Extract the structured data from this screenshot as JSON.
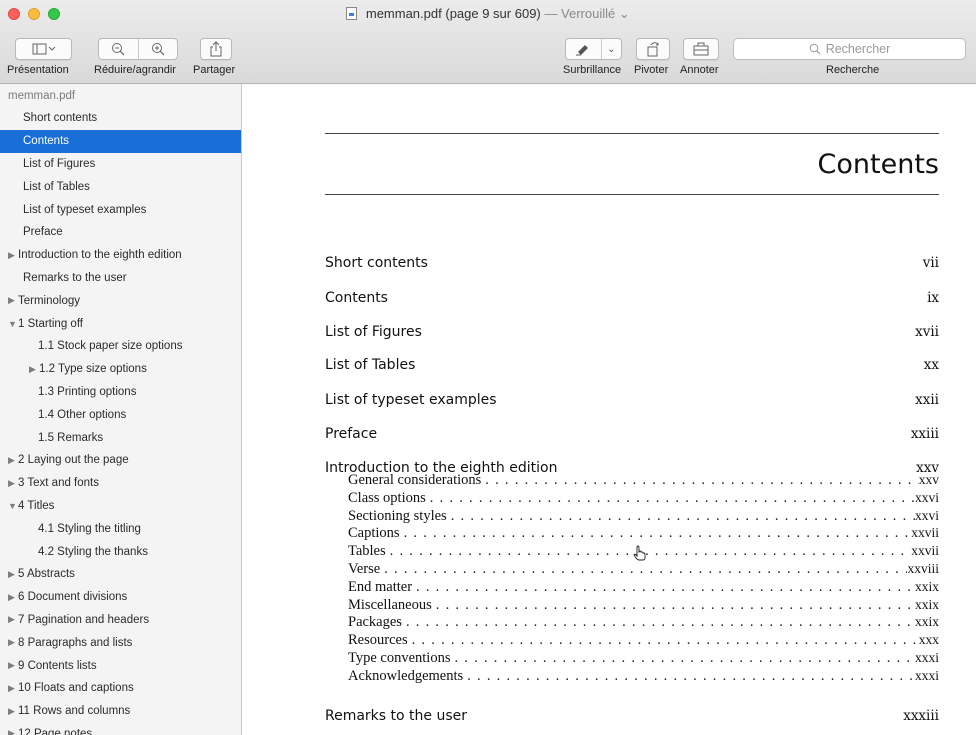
{
  "window": {
    "filename": "memman.pdf",
    "page_info": "(page 9 sur 609)",
    "separator": "—",
    "status": "Verrouillé"
  },
  "toolbar": {
    "presentation_label": "Présentation",
    "zoom_label": "Réduire/agrandir",
    "share_label": "Partager",
    "highlight_label": "Surbrillance",
    "rotate_label": "Pivoter",
    "annotate_label": "Annoter",
    "search_placeholder": "Rechercher",
    "search_label": "Recherche"
  },
  "sidebar": {
    "header": "memman.pdf",
    "items": [
      {
        "label": "Short contents",
        "level": 1,
        "arrow": "none",
        "selected": false
      },
      {
        "label": "Contents",
        "level": 1,
        "arrow": "none",
        "selected": true
      },
      {
        "label": "List of Figures",
        "level": 1,
        "arrow": "none",
        "selected": false
      },
      {
        "label": "List of Tables",
        "level": 1,
        "arrow": "none",
        "selected": false
      },
      {
        "label": "List of typeset examples",
        "level": 1,
        "arrow": "none",
        "selected": false
      },
      {
        "label": "Preface",
        "level": 1,
        "arrow": "none",
        "selected": false
      },
      {
        "label": "Introduction to the eighth edition",
        "level": 0,
        "arrow": "right",
        "selected": false
      },
      {
        "label": "Remarks to the user",
        "level": 1,
        "arrow": "none",
        "selected": false
      },
      {
        "label": "Terminology",
        "level": 0,
        "arrow": "right",
        "selected": false
      },
      {
        "label": "1 Starting off",
        "level": 0,
        "arrow": "down",
        "selected": false
      },
      {
        "label": "1.1 Stock paper size options",
        "level": 2,
        "arrow": "none",
        "selected": false
      },
      {
        "label": "1.2 Type size options",
        "level": 1.5,
        "arrow": "right",
        "selected": false
      },
      {
        "label": "1.3 Printing options",
        "level": 2,
        "arrow": "none",
        "selected": false
      },
      {
        "label": "1.4 Other options",
        "level": 2,
        "arrow": "none",
        "selected": false
      },
      {
        "label": "1.5 Remarks",
        "level": 2,
        "arrow": "none",
        "selected": false
      },
      {
        "label": "2 Laying out the page",
        "level": 0,
        "arrow": "right",
        "selected": false
      },
      {
        "label": "3 Text and fonts",
        "level": 0,
        "arrow": "right",
        "selected": false
      },
      {
        "label": "4 Titles",
        "level": 0,
        "arrow": "down",
        "selected": false
      },
      {
        "label": "4.1 Styling the titling",
        "level": 2,
        "arrow": "none",
        "selected": false
      },
      {
        "label": "4.2 Styling the thanks",
        "level": 2,
        "arrow": "none",
        "selected": false
      },
      {
        "label": "5 Abstracts",
        "level": 0,
        "arrow": "right",
        "selected": false
      },
      {
        "label": "6 Document divisions",
        "level": 0,
        "arrow": "right",
        "selected": false
      },
      {
        "label": "7 Pagination and headers",
        "level": 0,
        "arrow": "right",
        "selected": false
      },
      {
        "label": "8 Paragraphs and lists",
        "level": 0,
        "arrow": "right",
        "selected": false
      },
      {
        "label": "9 Contents lists",
        "level": 0,
        "arrow": "right",
        "selected": false
      },
      {
        "label": "10 Floats and captions",
        "level": 0,
        "arrow": "right",
        "selected": false
      },
      {
        "label": "11 Rows and columns",
        "level": 0,
        "arrow": "right",
        "selected": false
      },
      {
        "label": "12 Page notes",
        "level": 0,
        "arrow": "right",
        "selected": false
      }
    ]
  },
  "page": {
    "heading": "Contents",
    "main_entries": [
      {
        "title": "Short contents",
        "page": "vii"
      },
      {
        "title": "Contents",
        "page": "ix"
      },
      {
        "title": "List of Figures",
        "page": "xvii"
      },
      {
        "title": "List of Tables",
        "page": "xx"
      },
      {
        "title": "List of typeset examples",
        "page": "xxii"
      },
      {
        "title": "Preface",
        "page": "xxiii"
      },
      {
        "title": "Introduction to the eighth edition",
        "page": "xxv"
      }
    ],
    "sub_entries": [
      {
        "title": "General considerations",
        "page": "xxv"
      },
      {
        "title": "Class options",
        "page": "xxvi"
      },
      {
        "title": "Sectioning styles",
        "page": "xxvi"
      },
      {
        "title": "Captions",
        "page": "xxvii"
      },
      {
        "title": "Tables",
        "page": "xxvii"
      },
      {
        "title": "Verse",
        "page": "xxviii"
      },
      {
        "title": "End matter",
        "page": "xxix"
      },
      {
        "title": "Miscellaneous",
        "page": "xxix"
      },
      {
        "title": "Packages",
        "page": "xxix"
      },
      {
        "title": "Resources",
        "page": "xxx"
      },
      {
        "title": "Type conventions",
        "page": "xxxi"
      },
      {
        "title": "Acknowledgements",
        "page": "xxxi"
      }
    ],
    "last_entry": {
      "title": "Remarks to the user",
      "page": "xxxiii"
    }
  },
  "colors": {
    "selection": "#1a6ed8",
    "sidebar_bg": "#f4f4f4"
  }
}
